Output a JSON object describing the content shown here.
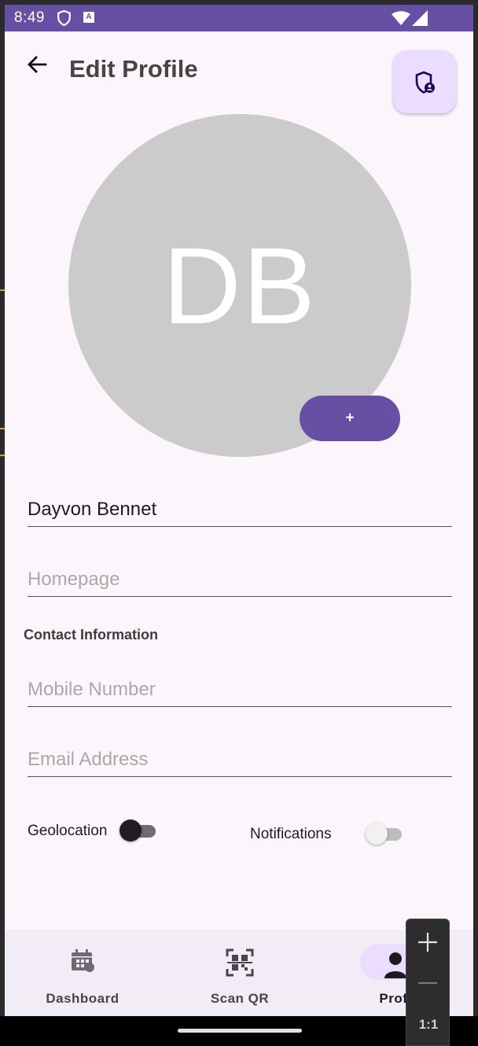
{
  "status_bar": {
    "time": "8:49",
    "shield_icon": "shield-icon",
    "a_badge": "A",
    "wifi_icon": "wifi-icon",
    "signal_icon": "signal-icon"
  },
  "header": {
    "back_icon": "arrow-back-icon",
    "title": "Edit Profile",
    "privacy_icon": "shield-person-icon"
  },
  "avatar": {
    "initials": "DB",
    "add_label": "+"
  },
  "form": {
    "name_value": "Dayvon Bennet",
    "homepage_placeholder": "Homepage",
    "contact_section_title": "Contact Information",
    "mobile_placeholder": "Mobile Number",
    "email_placeholder": "Email Address"
  },
  "toggles": {
    "geolocation_label": "Geolocation",
    "geolocation_on": false,
    "notifications_label": "Notifications",
    "notifications_on": false
  },
  "bottom_nav": {
    "items": [
      {
        "label": "Dashboard",
        "icon": "calendar-icon"
      },
      {
        "label": "Scan QR",
        "icon": "qr-scan-icon"
      },
      {
        "label": "Profi",
        "icon": "person-icon"
      }
    ]
  },
  "zoom_panel": {
    "ratio_label": "1:1"
  },
  "colors": {
    "primary": "#6750a4",
    "background": "#fdf5fc",
    "avatar": "#cbcbcb",
    "nav_background": "#f2ecf6",
    "active_pill": "#eaddff"
  }
}
